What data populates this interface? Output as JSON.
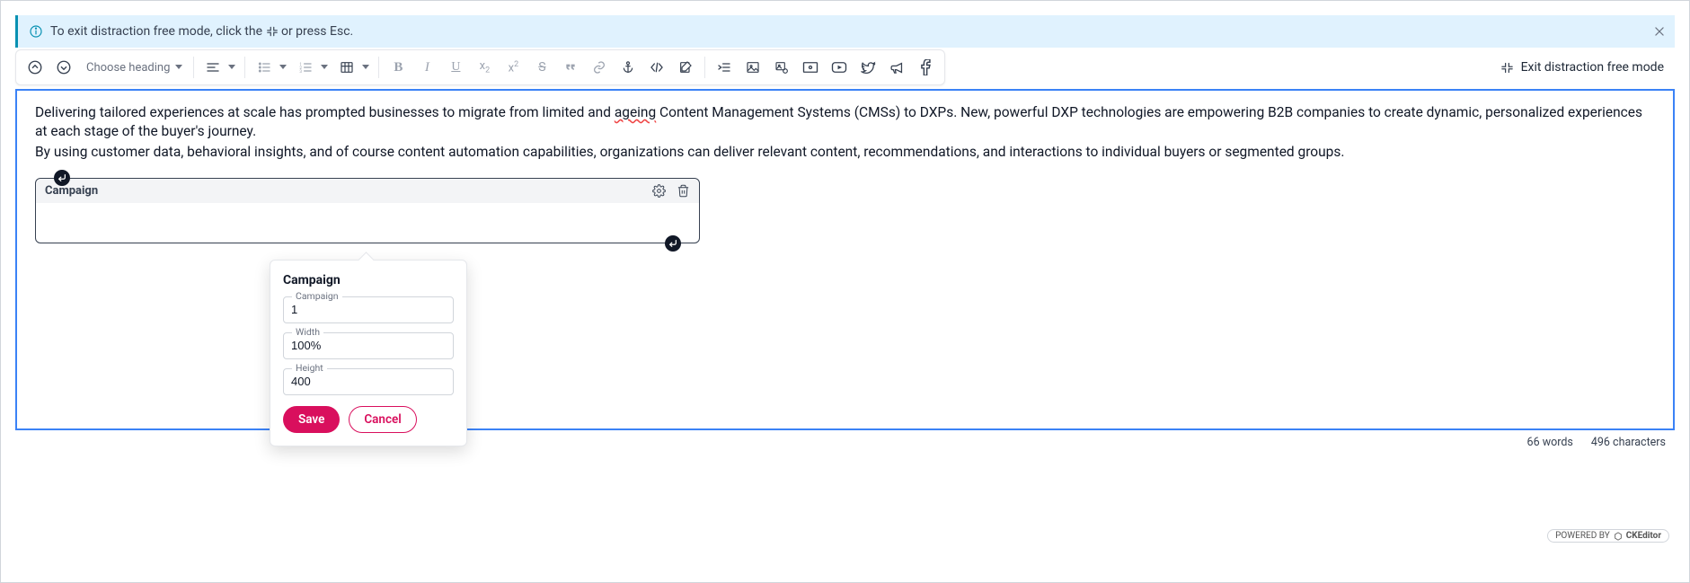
{
  "banner": {
    "text_prefix": "To exit distraction free mode, click the",
    "text_suffix": "or press Esc."
  },
  "toolbar": {
    "heading_placeholder": "Choose heading"
  },
  "exit_label": "Exit distraction free mode",
  "content": {
    "p1_a": "Delivering tailored experiences at scale has prompted businesses to migrate from limited and ",
    "p1_spell": "ageing",
    "p1_b": " Content Management Systems (CMSs) to DXPs. New, powerful DXP technologies are empowering B2B companies to create dynamic, personalized experiences at each stage of the buyer's journey.",
    "p2": "By using customer data, behavioral insights, and of course content automation capabilities, organizations can deliver relevant content, recommendations, and interactions to individual buyers or segmented groups."
  },
  "widget": {
    "title": "Campaign"
  },
  "popover": {
    "title": "Campaign",
    "fields": {
      "campaign": {
        "label": "Campaign",
        "value": "1"
      },
      "width": {
        "label": "Width",
        "value": "100%"
      },
      "height": {
        "label": "Height",
        "value": "400"
      }
    },
    "save_label": "Save",
    "cancel_label": "Cancel"
  },
  "footer": {
    "words_label": "66 words",
    "chars_label": "496 characters",
    "powered_prefix": "POWERED BY",
    "powered_brand": "CKEditor"
  }
}
